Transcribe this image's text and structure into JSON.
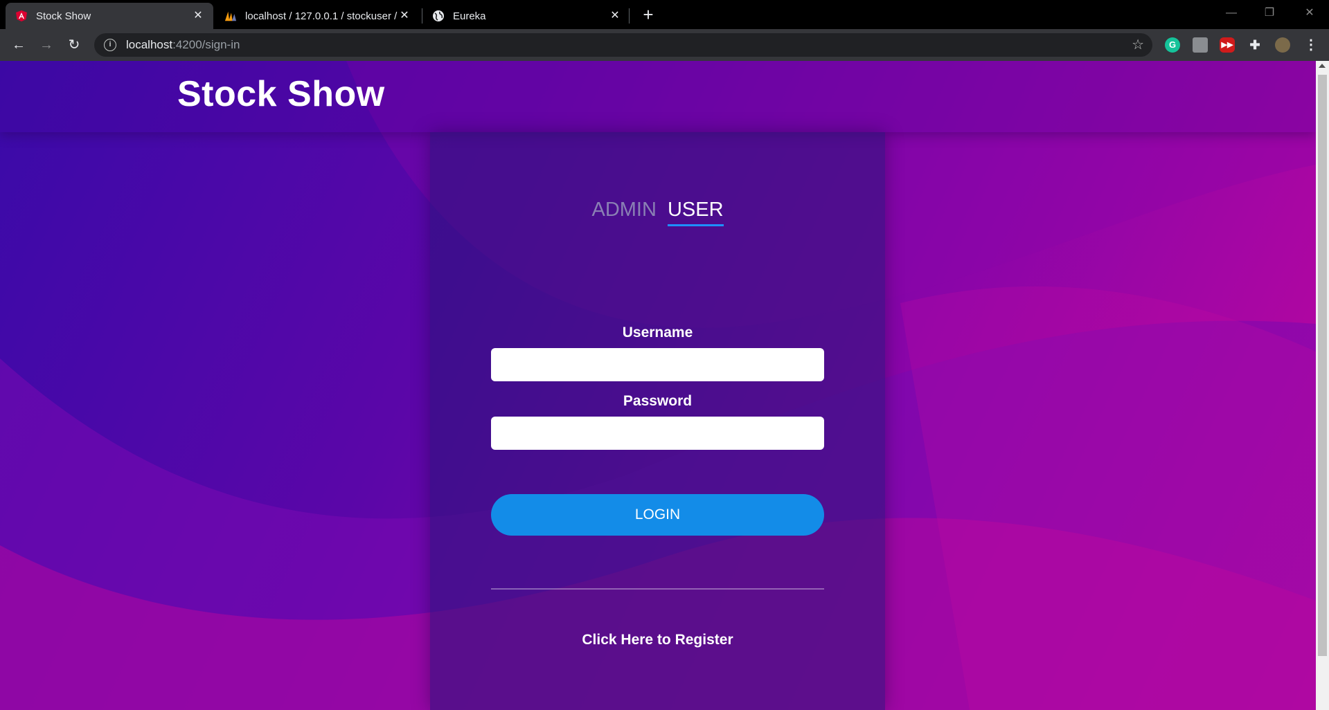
{
  "browser": {
    "tabs": [
      {
        "title": "Stock Show",
        "favicon": "angular-icon",
        "active": true
      },
      {
        "title": "localhost / 127.0.0.1 / stockuser /",
        "favicon": "phpmyadmin-icon",
        "active": false
      },
      {
        "title": "Eureka",
        "favicon": "globe-icon",
        "active": false
      }
    ],
    "address": {
      "host": "localhost",
      "path": ":4200/sign-in"
    }
  },
  "page": {
    "brand": "Stock Show",
    "tabs": {
      "admin": "ADMIN",
      "user": "USER",
      "selected": "USER"
    },
    "username": {
      "label": "Username",
      "value": ""
    },
    "password": {
      "label": "Password",
      "value": ""
    },
    "login_label": "LOGIN",
    "register_label": "Click Here to Register",
    "colors": {
      "accent": "#138ce8",
      "tab_underline": "#1e90ff"
    }
  }
}
